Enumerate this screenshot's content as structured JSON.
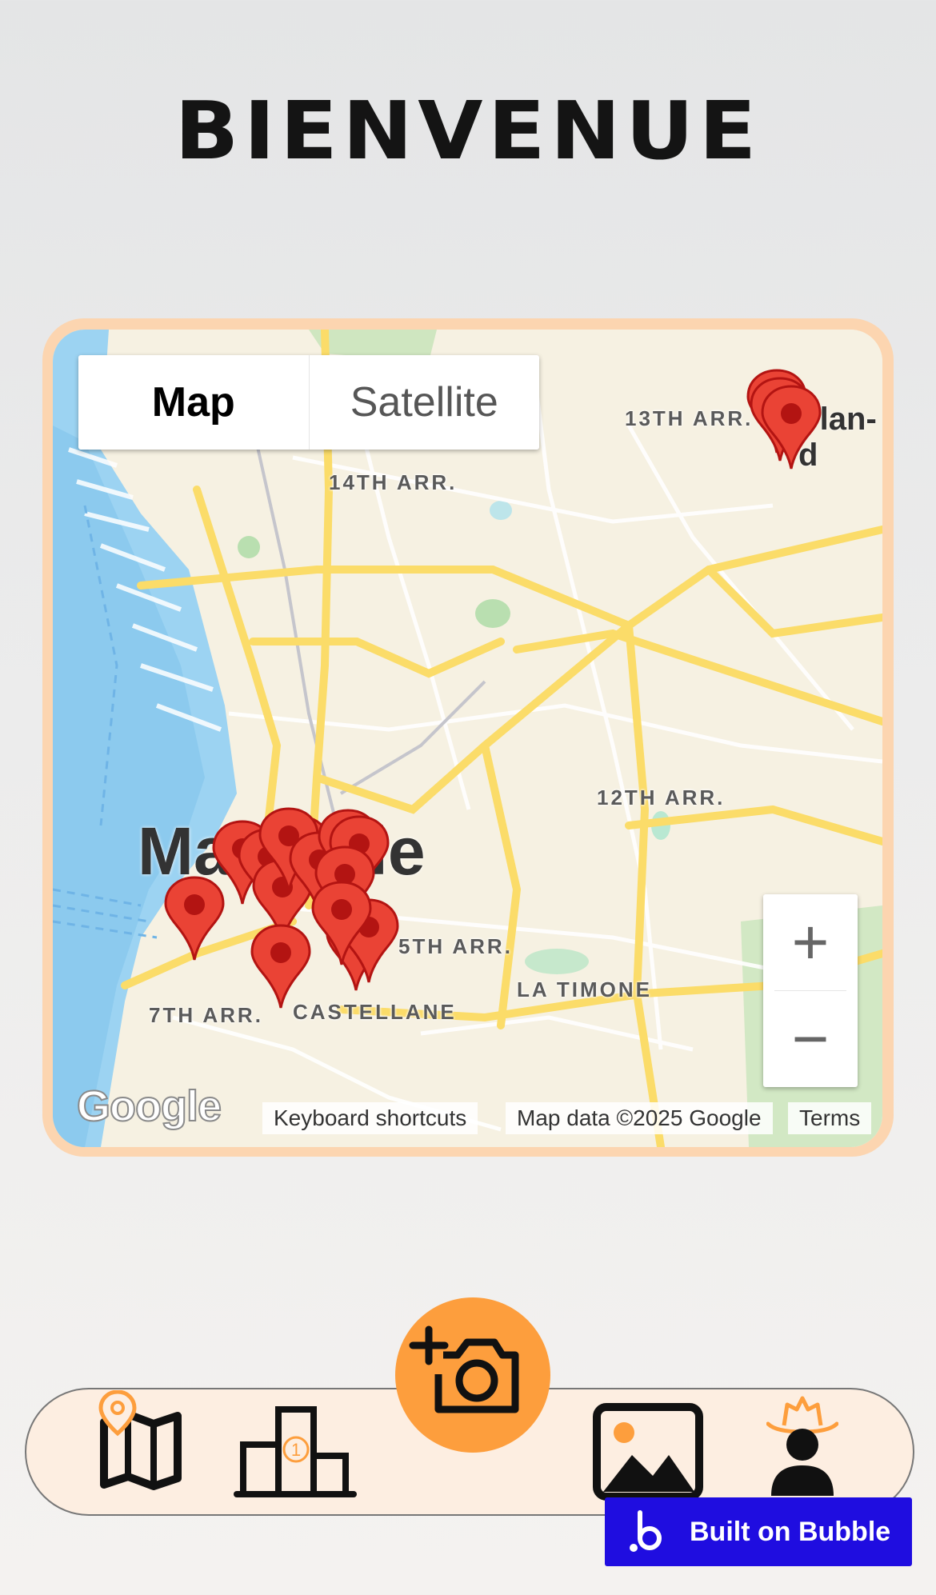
{
  "page": {
    "title": "BIENVENUE"
  },
  "map": {
    "type_buttons": [
      "Map",
      "Satellite"
    ],
    "active_type": "Map",
    "zoom_in_label": "+",
    "zoom_out_label": "−",
    "city_label": "Marseille",
    "place_labels": {
      "arr13": "13TH ARR.",
      "arr14": "14TH ARR.",
      "arr12": "12TH ARR.",
      "arr5": "5TH ARR.",
      "la_timone": "LA TIMONE",
      "arr7": "7TH ARR.",
      "castellane": "CASTELLANE",
      "plan": "Plan-d"
    },
    "google_logo": "Google",
    "attribution": {
      "shortcuts": "Keyboard shortcuts",
      "data": "Map data ©2025 Google",
      "terms": "Terms"
    },
    "pin_color": "#ea4335",
    "pin_count": 17
  },
  "nav": {
    "items": [
      {
        "icon": "map-location-icon"
      },
      {
        "icon": "podium-icon",
        "badge": "1"
      },
      {
        "icon": "add-photo-camera-icon"
      },
      {
        "icon": "gallery-image-icon"
      },
      {
        "icon": "cowboy-profile-icon"
      }
    ],
    "accent": "#fd9e3d"
  },
  "badge": {
    "label": "Built on Bubble",
    "color": "#1f0de0"
  }
}
